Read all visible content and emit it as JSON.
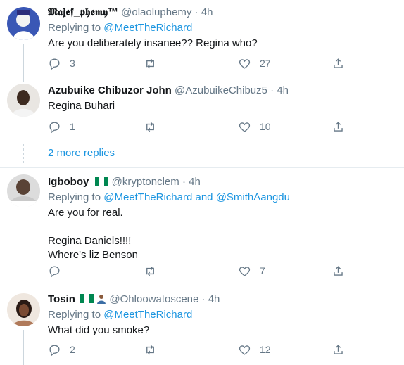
{
  "tweets": [
    {
      "name": "𝕸𝖆𝖏𝖊𝖋_𝖕𝖍𝖊𝖒𝖞™",
      "handle": "@olaoluphemy",
      "time": "4h",
      "replying_label": "Replying to",
      "mentions": [
        "@MeetTheRichard"
      ],
      "text": "Are you deliberately insanee?? Regina who?",
      "reply_count": "3",
      "retweet_count": "",
      "like_count": "27"
    },
    {
      "name": "Azubuike Chibuzor John",
      "handle": "@AzubuikeChibuz5",
      "time": "4h",
      "text": "Regina Buhari",
      "reply_count": "1",
      "retweet_count": "",
      "like_count": "10"
    },
    {
      "name": "Igboboy",
      "handle": "@kryptonclem",
      "time": "4h",
      "replying_label": "Replying to",
      "mentions": [
        "@MeetTheRichard",
        "@SmithAangdu"
      ],
      "mention_joiner": "and",
      "text": "Are you for real.\n\nRegina Daniels!!!!\nWhere's liz Benson",
      "reply_count": "",
      "retweet_count": "",
      "like_count": "7"
    },
    {
      "name": "Tosin",
      "handle": "@Ohloowatoscene",
      "time": "4h",
      "replying_label": "Replying to",
      "mentions": [
        "@MeetTheRichard"
      ],
      "text": "What did you smoke?",
      "reply_count": "2",
      "retweet_count": "",
      "like_count": "12"
    }
  ],
  "more_replies": "2 more replies",
  "separator": "·",
  "colors": {
    "accent": "#1b95e0",
    "muted": "#657786",
    "nigeria_green": "#008751"
  },
  "icons": {
    "reply": "reply-icon",
    "retweet": "retweet-icon",
    "like": "heart-icon",
    "share": "share-icon"
  }
}
